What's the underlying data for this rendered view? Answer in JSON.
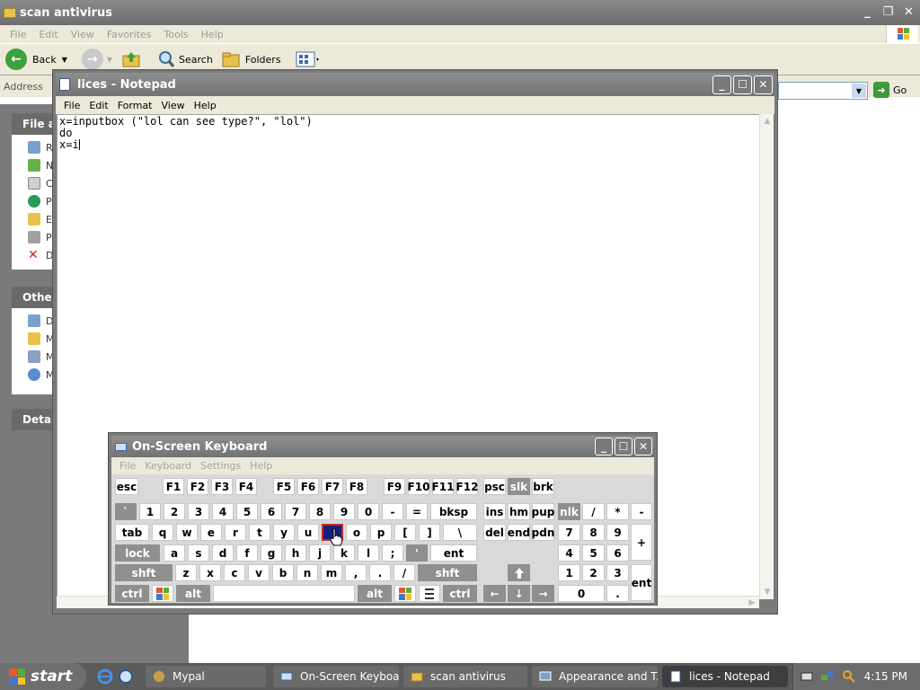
{
  "explorer": {
    "title": "scan antivirus",
    "menu": [
      "File",
      "Edit",
      "View",
      "Favorites",
      "Tools",
      "Help"
    ],
    "toolbar": {
      "back_label": "Back",
      "search_label": "Search",
      "folders_label": "Folders"
    },
    "address_label": "Address",
    "go_label": "Go",
    "task_pane": {
      "file_tasks_header": "File an",
      "file_tasks_items": [
        "R",
        "N",
        "C",
        "P",
        "E",
        "P",
        "D"
      ],
      "other_places_header": "Other",
      "other_places_items": [
        "Do",
        "M",
        "M",
        "M"
      ],
      "details_header": "Detail"
    }
  },
  "notepad": {
    "title": "lices - Notepad",
    "menu": [
      "File",
      "Edit",
      "Format",
      "View",
      "Help"
    ],
    "lines": [
      "x=inputbox (\"lol can see type?\", \"lol\")",
      "do",
      "x=i"
    ]
  },
  "osk": {
    "title": "On-Screen Keyboard",
    "menu": [
      "File",
      "Keyboard",
      "Settings",
      "Help"
    ],
    "keys": {
      "esc": "esc",
      "f1": "F1",
      "f2": "F2",
      "f3": "F3",
      "f4": "F4",
      "f5": "F5",
      "f6": "F6",
      "f7": "F7",
      "f8": "F8",
      "f9": "F9",
      "f10": "F10",
      "f11": "F11",
      "f12": "F12",
      "psc": "psc",
      "slk": "slk",
      "brk": "brk",
      "backtick": "`",
      "n1": "1",
      "n2": "2",
      "n3": "3",
      "n4": "4",
      "n5": "5",
      "n6": "6",
      "n7": "7",
      "n8": "8",
      "n9": "9",
      "n0": "0",
      "minus": "-",
      "equals": "=",
      "bksp": "bksp",
      "ins": "ins",
      "hm": "hm",
      "pup": "pup",
      "nlk": "nlk",
      "np_div": "/",
      "np_mul": "*",
      "np_sub": "-",
      "tab": "tab",
      "q": "q",
      "w": "w",
      "e": "e",
      "r": "r",
      "t": "t",
      "y": "y",
      "u": "u",
      "i": "i",
      "o": "o",
      "p": "p",
      "lbracket": "[",
      "rbracket": "]",
      "backslash": "\\",
      "del": "del",
      "end": "end",
      "pdn": "pdn",
      "np7": "7",
      "np8": "8",
      "np9": "9",
      "np_add": "+",
      "lock": "lock",
      "a": "a",
      "s": "s",
      "d": "d",
      "f": "f",
      "g": "g",
      "h": "h",
      "j": "j",
      "k": "k",
      "l": "l",
      "semicolon": ";",
      "quote": "'",
      "ent": "ent",
      "np4": "4",
      "np5": "5",
      "np6": "6",
      "lshift": "shft",
      "z": "z",
      "x": "x",
      "c": "c",
      "v": "v",
      "b": "b",
      "n": "n",
      "m": "m",
      "comma": ",",
      "period": ".",
      "slash": "/",
      "rshift": "shft",
      "up": "🡅",
      "np1": "1",
      "np2": "2",
      "np3": "3",
      "np_ent": "ent",
      "lctrl": "ctrl",
      "lalt": "alt",
      "ralt": "alt",
      "rctrl": "ctrl",
      "left": "←",
      "down": "↓",
      "right": "→",
      "np0": "0",
      "np_dot": "."
    },
    "active_key": "i"
  },
  "taskbar": {
    "start_label": "start",
    "tasks": [
      "Mypal",
      "On-Screen Keyboard",
      "scan antivirus",
      "Appearance and T...",
      "lices - Notepad"
    ],
    "active_task": "lices - Notepad",
    "clock": "4:15 PM"
  },
  "colors": {
    "title_grey": "#7d7d7d",
    "active_key": "#15207a",
    "active_key_border": "#c62a2a",
    "taskbar": "#5b5b5b"
  }
}
